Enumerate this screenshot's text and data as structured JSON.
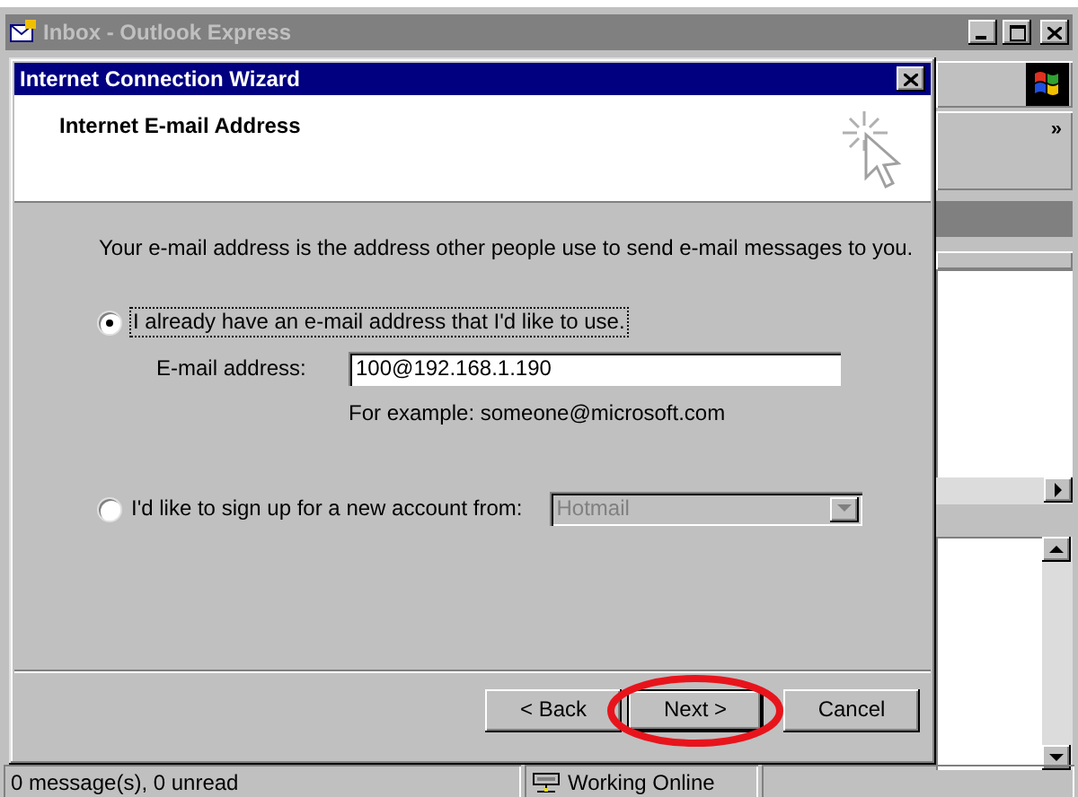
{
  "window": {
    "title": "Inbox - Outlook Express",
    "active": false
  },
  "toolbar": {
    "overflow": "»"
  },
  "wizard": {
    "title": "Internet Connection Wizard",
    "heading": "Internet E-mail Address",
    "intro": "Your e-mail address is the address other people use to send e-mail messages to you.",
    "options": [
      {
        "label": "I already have an e-mail address that I'd like to use.",
        "selected": true,
        "focused": true
      },
      {
        "label": "I'd like to sign up for a new account from:",
        "selected": false,
        "focused": false
      }
    ],
    "email": {
      "label": "E-mail address:",
      "value": "100@192.168.1.190",
      "hint": "For example: someone@microsoft.com"
    },
    "provider": {
      "value": "Hotmail",
      "disabled": true
    },
    "buttons": [
      {
        "label": "< Back",
        "circled": false
      },
      {
        "label": "Next >",
        "circled": true
      },
      {
        "label": "Cancel",
        "circled": false
      }
    ]
  },
  "status_bar": {
    "messages": "0 message(s), 0 unread",
    "connection": "Working Online"
  }
}
